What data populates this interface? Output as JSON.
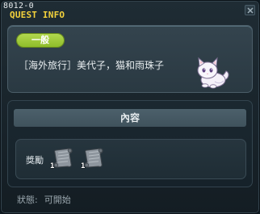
{
  "window": {
    "quest_id": "8012-0",
    "title": "QUEST INFO"
  },
  "quest": {
    "category": "一般",
    "name": "［海外旅行］美代子，猫和雨珠子",
    "npc_icon": "white-cat-portrait"
  },
  "content": {
    "header": "內容",
    "reward_label": "獎勵",
    "rewards": [
      {
        "icon": "scroll-icon",
        "quantity": "1"
      },
      {
        "icon": "scroll-icon",
        "quantity": "1"
      }
    ]
  },
  "status": {
    "label": "狀態:",
    "value": "可開始"
  },
  "colors": {
    "title": "#f4d23c",
    "badge": "#9ccb36",
    "background": "#1b2830"
  }
}
